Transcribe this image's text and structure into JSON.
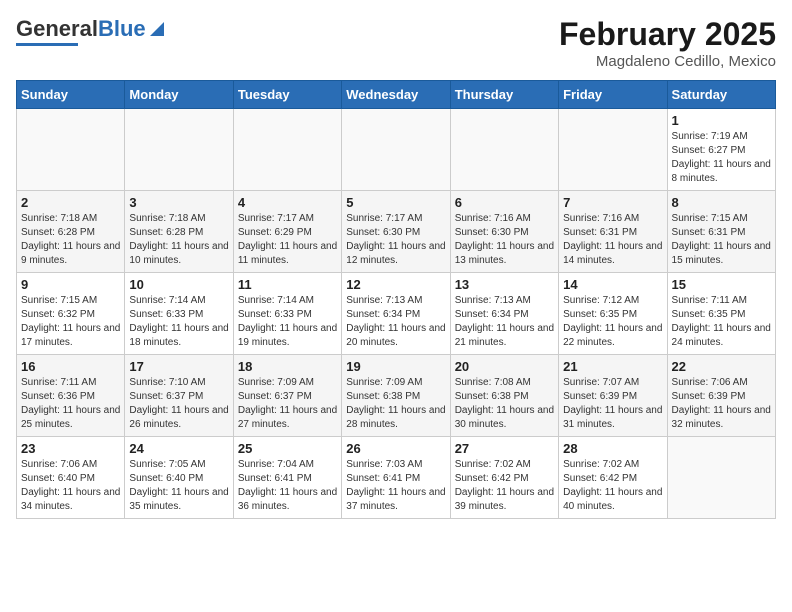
{
  "header": {
    "logo_general": "General",
    "logo_blue": "Blue",
    "month_year": "February 2025",
    "location": "Magdaleno Cedillo, Mexico"
  },
  "weekdays": [
    "Sunday",
    "Monday",
    "Tuesday",
    "Wednesday",
    "Thursday",
    "Friday",
    "Saturday"
  ],
  "weeks": [
    [
      {
        "day": "",
        "info": ""
      },
      {
        "day": "",
        "info": ""
      },
      {
        "day": "",
        "info": ""
      },
      {
        "day": "",
        "info": ""
      },
      {
        "day": "",
        "info": ""
      },
      {
        "day": "",
        "info": ""
      },
      {
        "day": "1",
        "info": "Sunrise: 7:19 AM\nSunset: 6:27 PM\nDaylight: 11 hours and 8 minutes."
      }
    ],
    [
      {
        "day": "2",
        "info": "Sunrise: 7:18 AM\nSunset: 6:28 PM\nDaylight: 11 hours and 9 minutes."
      },
      {
        "day": "3",
        "info": "Sunrise: 7:18 AM\nSunset: 6:28 PM\nDaylight: 11 hours and 10 minutes."
      },
      {
        "day": "4",
        "info": "Sunrise: 7:17 AM\nSunset: 6:29 PM\nDaylight: 11 hours and 11 minutes."
      },
      {
        "day": "5",
        "info": "Sunrise: 7:17 AM\nSunset: 6:30 PM\nDaylight: 11 hours and 12 minutes."
      },
      {
        "day": "6",
        "info": "Sunrise: 7:16 AM\nSunset: 6:30 PM\nDaylight: 11 hours and 13 minutes."
      },
      {
        "day": "7",
        "info": "Sunrise: 7:16 AM\nSunset: 6:31 PM\nDaylight: 11 hours and 14 minutes."
      },
      {
        "day": "8",
        "info": "Sunrise: 7:15 AM\nSunset: 6:31 PM\nDaylight: 11 hours and 15 minutes."
      }
    ],
    [
      {
        "day": "9",
        "info": "Sunrise: 7:15 AM\nSunset: 6:32 PM\nDaylight: 11 hours and 17 minutes."
      },
      {
        "day": "10",
        "info": "Sunrise: 7:14 AM\nSunset: 6:33 PM\nDaylight: 11 hours and 18 minutes."
      },
      {
        "day": "11",
        "info": "Sunrise: 7:14 AM\nSunset: 6:33 PM\nDaylight: 11 hours and 19 minutes."
      },
      {
        "day": "12",
        "info": "Sunrise: 7:13 AM\nSunset: 6:34 PM\nDaylight: 11 hours and 20 minutes."
      },
      {
        "day": "13",
        "info": "Sunrise: 7:13 AM\nSunset: 6:34 PM\nDaylight: 11 hours and 21 minutes."
      },
      {
        "day": "14",
        "info": "Sunrise: 7:12 AM\nSunset: 6:35 PM\nDaylight: 11 hours and 22 minutes."
      },
      {
        "day": "15",
        "info": "Sunrise: 7:11 AM\nSunset: 6:35 PM\nDaylight: 11 hours and 24 minutes."
      }
    ],
    [
      {
        "day": "16",
        "info": "Sunrise: 7:11 AM\nSunset: 6:36 PM\nDaylight: 11 hours and 25 minutes."
      },
      {
        "day": "17",
        "info": "Sunrise: 7:10 AM\nSunset: 6:37 PM\nDaylight: 11 hours and 26 minutes."
      },
      {
        "day": "18",
        "info": "Sunrise: 7:09 AM\nSunset: 6:37 PM\nDaylight: 11 hours and 27 minutes."
      },
      {
        "day": "19",
        "info": "Sunrise: 7:09 AM\nSunset: 6:38 PM\nDaylight: 11 hours and 28 minutes."
      },
      {
        "day": "20",
        "info": "Sunrise: 7:08 AM\nSunset: 6:38 PM\nDaylight: 11 hours and 30 minutes."
      },
      {
        "day": "21",
        "info": "Sunrise: 7:07 AM\nSunset: 6:39 PM\nDaylight: 11 hours and 31 minutes."
      },
      {
        "day": "22",
        "info": "Sunrise: 7:06 AM\nSunset: 6:39 PM\nDaylight: 11 hours and 32 minutes."
      }
    ],
    [
      {
        "day": "23",
        "info": "Sunrise: 7:06 AM\nSunset: 6:40 PM\nDaylight: 11 hours and 34 minutes."
      },
      {
        "day": "24",
        "info": "Sunrise: 7:05 AM\nSunset: 6:40 PM\nDaylight: 11 hours and 35 minutes."
      },
      {
        "day": "25",
        "info": "Sunrise: 7:04 AM\nSunset: 6:41 PM\nDaylight: 11 hours and 36 minutes."
      },
      {
        "day": "26",
        "info": "Sunrise: 7:03 AM\nSunset: 6:41 PM\nDaylight: 11 hours and 37 minutes."
      },
      {
        "day": "27",
        "info": "Sunrise: 7:02 AM\nSunset: 6:42 PM\nDaylight: 11 hours and 39 minutes."
      },
      {
        "day": "28",
        "info": "Sunrise: 7:02 AM\nSunset: 6:42 PM\nDaylight: 11 hours and 40 minutes."
      },
      {
        "day": "",
        "info": ""
      }
    ]
  ]
}
